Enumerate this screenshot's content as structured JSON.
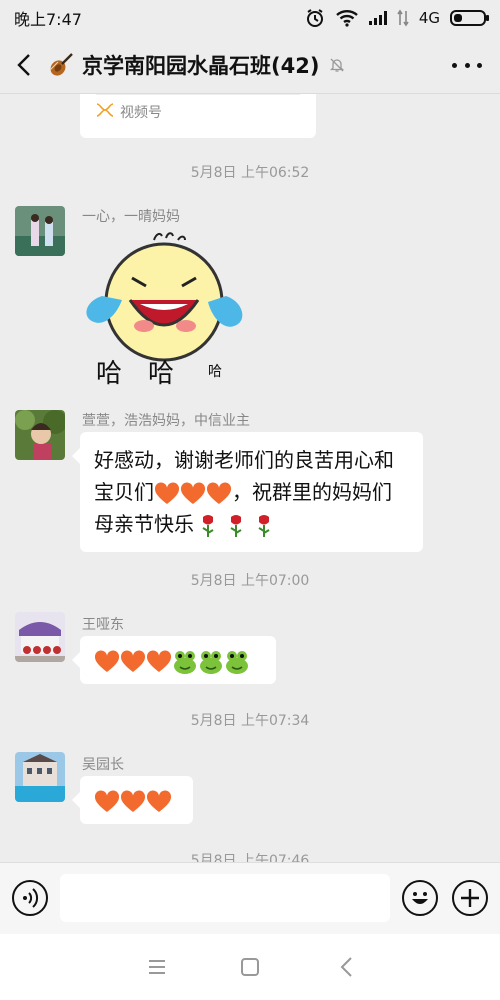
{
  "status_bar": {
    "time": "晚上7:47",
    "network": "4G"
  },
  "header": {
    "title": "京学南阳园水晶石班(42)",
    "back_icon": "chevron-left-icon",
    "more_icon": "more-dots-icon",
    "muted_icon": "bell-off-icon"
  },
  "video_card": {
    "label": "视频号"
  },
  "messages": [
    {
      "timestamp": "5月8日 上午06:52",
      "sender": "一心，一晴妈妈",
      "type": "sticker",
      "sticker_text": "哈  哈  哈"
    },
    {
      "sender": "萱萱，浩浩妈妈，中信业主",
      "type": "text",
      "line1": "好感动，谢谢老师们的良苦用心和",
      "line2_a": "宝贝们",
      "line2_b": "，祝群里的妈妈们",
      "line3": "母亲节快乐"
    },
    {
      "timestamp": "5月8日 上午07:00",
      "sender": "王哑东",
      "type": "emoji"
    },
    {
      "timestamp": "5月8日 上午07:34",
      "sender": "吴园长",
      "type": "emoji"
    },
    {
      "timestamp": "5月8日 上午07:46"
    }
  ],
  "input": {
    "placeholder": ""
  },
  "colors": {
    "background": "#ededed",
    "bubble": "#ffffff",
    "heart": "#f26a2e",
    "frog": "#7cc23a"
  }
}
